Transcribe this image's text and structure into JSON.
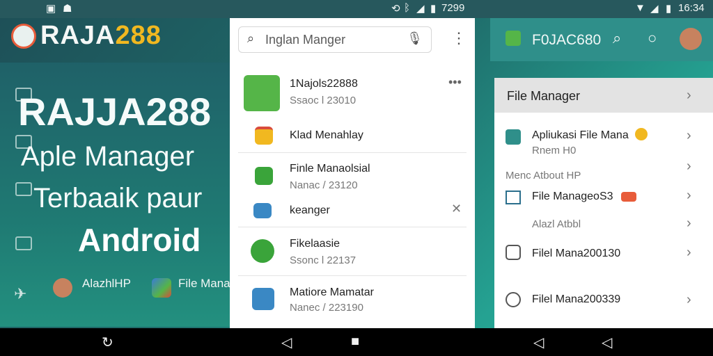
{
  "status_left": {
    "time": "7299"
  },
  "status_right": {
    "time": "16:34"
  },
  "brand": {
    "logo_text_a": "RAJA",
    "logo_text_b": "288"
  },
  "hero": {
    "line1": "RAJJA288",
    "line2": "Aple Manager",
    "line3": "Terbaaik paur",
    "line4": "Android"
  },
  "bottom_left_chips": [
    {
      "label": "AlazhlHP"
    },
    {
      "label": "File Manag"
    }
  ],
  "middle_panel": {
    "search_placeholder": "Inglan Manger",
    "items": [
      {
        "title": "1Najols22888",
        "sub": "Ssaoc l 23010"
      },
      {
        "title": "Klad Menahlay",
        "sub": ""
      },
      {
        "title": "Finle Manaolsial",
        "sub": "Nanac / 23120"
      },
      {
        "title": "keanger",
        "sub": ""
      },
      {
        "title": "Fikelaasie",
        "sub": "Ssonc l 22137"
      },
      {
        "title": "Matiore Mamatar",
        "sub": "Nanec / 223190"
      }
    ]
  },
  "right_header": {
    "title": "F0JAC680"
  },
  "right_panel": {
    "head_title": "File Manager",
    "items": [
      {
        "title": "Apliukasi File Mana",
        "sub": "Rnem H0"
      },
      {
        "title": "Menc Atbout HP",
        "sub": ""
      },
      {
        "title": "File ManageoS3",
        "sub": ""
      },
      {
        "title": "Alazl Atbbl",
        "sub": ""
      },
      {
        "title": "Filel Mana200130",
        "sub": ""
      },
      {
        "title": "Filel Mana200339",
        "sub": ""
      }
    ]
  },
  "colors": {
    "accent_green": "#55b548",
    "brand_yellow": "#f1b820",
    "header_teal": "#2f8f8a"
  }
}
